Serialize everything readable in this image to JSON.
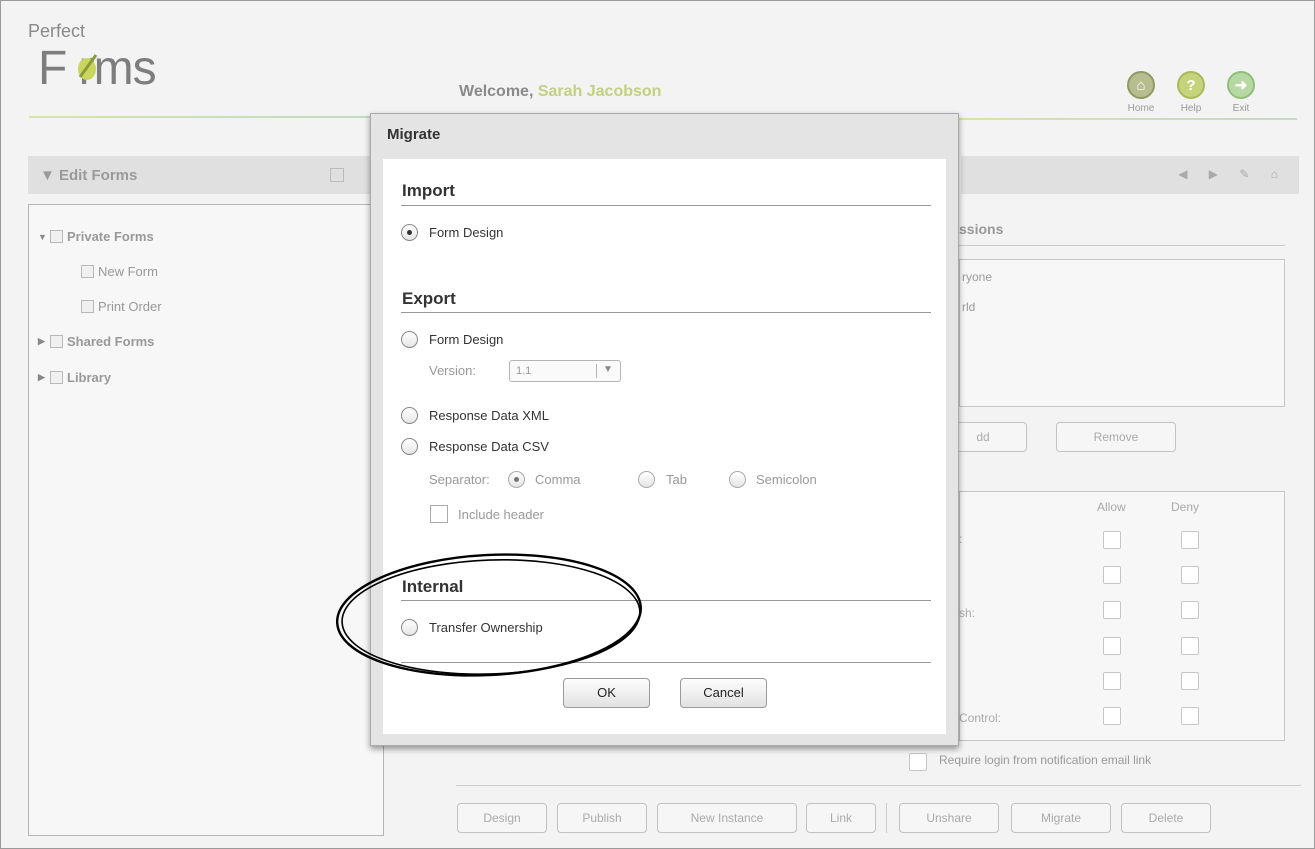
{
  "header": {
    "logo_small": "Perfect",
    "logo_big": "F  rms",
    "welcome_prefix": "Welcome, ",
    "user_name": "Sarah Jacobson",
    "home_label": "Home",
    "help_label": "Help",
    "exit_label": "Exit"
  },
  "left_panel": {
    "title": "▼  Edit Forms",
    "tree": [
      {
        "label": "Private Forms",
        "arrow": "▼"
      },
      {
        "label": "New Form"
      },
      {
        "label": "Print Order"
      },
      {
        "label": "Shared Forms",
        "arrow": "▶"
      },
      {
        "label": "Library",
        "arrow": "▶"
      }
    ]
  },
  "right_panel": {
    "header_icons": "◀ ▶ ✎ ⌂",
    "permissions_title": "ssions",
    "list_items": [
      "ryone",
      "rld"
    ],
    "add_label": "dd",
    "remove_label": "Remove",
    "allow_label": "Allow",
    "deny_label": "Deny",
    "row_label_1": ":",
    "row_label_3": "sh:",
    "row_label_6": "Control:",
    "require_login": "Require login from notification email link"
  },
  "bottom_buttons": {
    "design": "Design",
    "publish": "Publish",
    "new_instance": "New Instance",
    "link": "Link",
    "unshare": "Unshare",
    "migrate": "Migrate",
    "delete": "Delete"
  },
  "dialog": {
    "title": "Migrate",
    "import_title": "Import",
    "import_form_design": "Form Design",
    "export_title": "Export",
    "export_form_design": "Form Design",
    "version_label": "Version:",
    "version_value": "1.1",
    "response_xml": "Response Data XML",
    "response_csv": "Response Data CSV",
    "separator_label": "Separator:",
    "sep_comma": "Comma",
    "sep_tab": "Tab",
    "sep_semicolon": "Semicolon",
    "include_header": "Include header",
    "internal_title": "Internal",
    "transfer_ownership": "Transfer Ownership",
    "ok": "OK",
    "cancel": "Cancel"
  }
}
